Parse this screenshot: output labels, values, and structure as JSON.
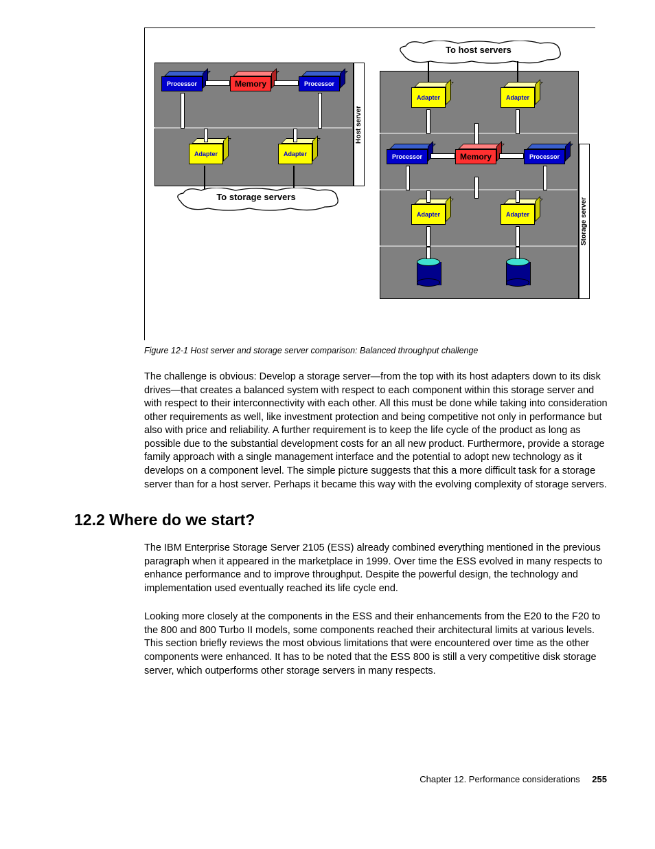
{
  "figure": {
    "host": {
      "processor": "Processor",
      "memory": "Memory",
      "adapter": "Adapter",
      "vertical_label": "Host server",
      "cloud": "To storage servers"
    },
    "storage": {
      "processor": "Processor",
      "memory": "Memory",
      "adapter": "Adapter",
      "vertical_label": "Storage server",
      "cloud": "To host servers"
    },
    "caption": "Figure 12-1   Host server and storage server comparison: Balanced throughput challenge"
  },
  "paragraphs": {
    "p1": "The challenge is obvious: Develop a storage server—from the top with its host adapters down to its disk drives—that creates a balanced system with respect to each component within this storage server and with respect to their interconnectivity with each other. All this must be done while taking into consideration other requirements as well, like investment protection and being competitive not only in performance but also with price and reliability. A further requirement is to keep the life cycle of the product as long as possible due to the substantial development costs for an all new product. Furthermore, provide a storage family approach with a single management interface and the potential to adopt new technology as it develops on a component level. The simple picture suggests that this a more difficult task for a storage server than for a host server. Perhaps it became this way with the evolving complexity of storage servers.",
    "p2": "The IBM Enterprise Storage Server 2105 (ESS) already combined everything mentioned in the previous paragraph when it appeared in the marketplace in 1999. Over time the ESS evolved in many respects to enhance performance and to improve throughput. Despite the powerful design, the technology and implementation used eventually reached its life cycle end.",
    "p3": "Looking more closely at the components in the ESS and their enhancements from the E20 to the F20 to the 800 and 800 Turbo II models, some components reached their architectural limits at various levels. This section briefly reviews the most obvious limitations that were encountered over time as the other components were enhanced. It has to be noted that the ESS 800 is still a very competitive disk storage server, which outperforms other storage servers in many respects."
  },
  "section_heading": "12.2  Where do we start?",
  "footer": {
    "chapter": "Chapter 12. Performance considerations",
    "page": "255"
  }
}
